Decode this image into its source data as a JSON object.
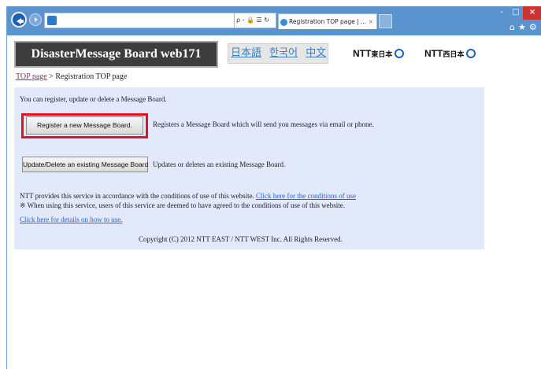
{
  "browser": {
    "address_tools": "ρ - 🔒 ☰ ↻",
    "tab_title": "Registration TOP page | ...",
    "tab_close": "×",
    "window_controls": {
      "minimize": "-",
      "maximize": "□",
      "close": "×"
    },
    "tool_icons": "⌂★⚙"
  },
  "header": {
    "title": "DisasterMessage Board web171",
    "languages": [
      "日本語",
      "한국어",
      "中文"
    ],
    "ntt_east": {
      "name": "NTT",
      "region": "東日本"
    },
    "ntt_west": {
      "name": "NTT",
      "region": "西日本"
    }
  },
  "breadcrumb": {
    "home": "TOP page",
    "separator": " > ",
    "current": "Registration TOP page"
  },
  "main": {
    "intro": "You can register, update or delete a Message Board.",
    "register_button": "Register a new Message Board.",
    "register_desc": "Registers a Message Board which will send you messages via email or phone.",
    "update_button": "Update/Delete an existing Message Board",
    "update_desc": "Updates or deletes an existing Message Board.",
    "conditions_text": "NTT provides this service in accordance with the conditions of use of this website.",
    "conditions_link": "Click here for the conditions of use",
    "note": "※ When using this service, users of this service are deemed to have agreed to the conditions of use of this website.",
    "howto_link": "Click here for details on how to use.",
    "copyright": "Copyright (C) 2012 NTT EAST / NTT WEST Inc. All Rights Reserved."
  },
  "colors": {
    "titlebar": "#5b93cf",
    "header_band": "#3d3d3d",
    "panel": "#e2e9fa",
    "highlight": "#e3101f",
    "link": "#2266cc",
    "visited_link": "#8a2e7c"
  }
}
